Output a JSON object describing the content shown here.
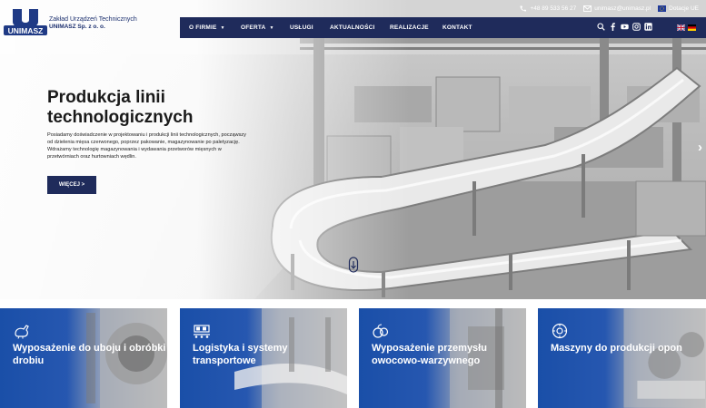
{
  "brand": {
    "logo_text": "UNIMASZ",
    "company_line1": "Zakład Urządzeń Technicznych",
    "company_line2": "UNIMASZ Sp. z o. o."
  },
  "topbar": {
    "phone": "+48 89 533 56 27",
    "email": "unimasz@unimasz.pl",
    "eu_label": "Dotacje UE"
  },
  "nav": {
    "items": [
      {
        "label": "O FIRMIE",
        "dropdown": true
      },
      {
        "label": "OFERTA",
        "dropdown": true
      },
      {
        "label": "USŁUGI",
        "dropdown": false
      },
      {
        "label": "AKTUALNOŚCI",
        "dropdown": false
      },
      {
        "label": "REALIZACJE",
        "dropdown": false
      },
      {
        "label": "KONTAKT",
        "dropdown": false
      }
    ],
    "caret": "▼",
    "icons": [
      "search-icon",
      "facebook-icon",
      "youtube-icon",
      "instagram-icon",
      "linkedin-icon"
    ],
    "languages": [
      "en",
      "de"
    ],
    "bar_color": "#1f2b5b"
  },
  "hero": {
    "title": "Produkcja linii technologicznych",
    "text": "Posiadamy doświadczenie w projektowaniu i produkcji linii technologicznych, począwszy od dzielenia mięsa czerwonego, poprzez pakowanie, magazynowanie po paletyzację. Wdrażamy technologię magazynowania i wydawania przetworów mięsnych w przetwórniach oraz hurtowniach wędlin.",
    "button": "WIĘCEJ >",
    "prev": "‹",
    "next": "›"
  },
  "cards": [
    {
      "title": "Wyposażenie do uboju i obróbki drobiu",
      "icon": "poultry-icon"
    },
    {
      "title": "Logistyka i systemy transportowe",
      "icon": "conveyor-icon"
    },
    {
      "title": "Wyposażenie przemysłu owocowo-warzywnego",
      "icon": "fruit-icon"
    },
    {
      "title": "Maszyny do produkcji opon",
      "icon": "tire-icon"
    }
  ],
  "colors": {
    "brand_navy": "#1f2b5b",
    "card_blue": "#1a4fa8"
  }
}
